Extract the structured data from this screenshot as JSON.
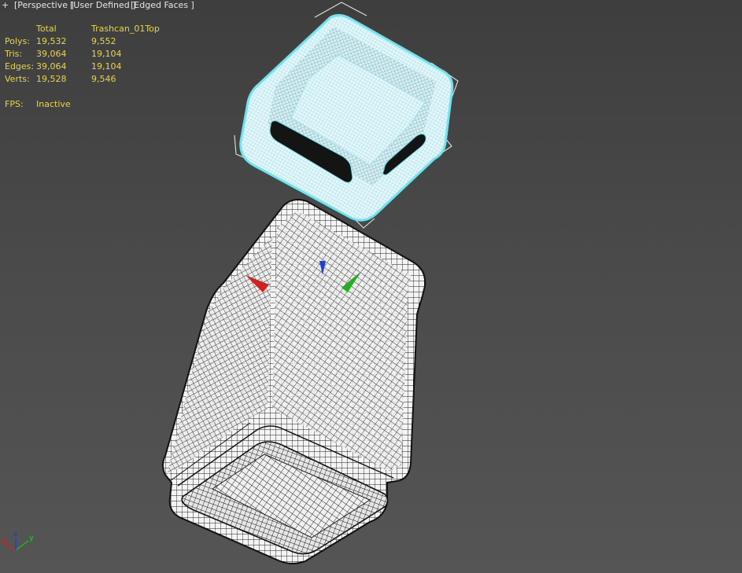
{
  "viewport_labels": {
    "plus": "+",
    "view": "[Perspective ]",
    "user_defined": "[User Defined ]",
    "shading": "[Edged Faces ]"
  },
  "stats": {
    "header": {
      "total": "Total",
      "selected": "Trashcan_01Top"
    },
    "rows": [
      {
        "label": "Polys:",
        "total": "19,532",
        "selected": "9,552"
      },
      {
        "label": "Tris:",
        "total": "39,064",
        "selected": "19,104"
      },
      {
        "label": "Edges:",
        "total": "39,064",
        "selected": "19,104"
      },
      {
        "label": "Verts:",
        "total": "19,528",
        "selected": "9,546"
      }
    ],
    "fps": {
      "label": "FPS:",
      "value": "Inactive"
    }
  },
  "axis_tripod": {
    "x": "x",
    "y": "y",
    "z": "z"
  },
  "colors": {
    "stats_text": "#e8d44d",
    "selection": "#6fe3f0",
    "background": "#4a4a4a",
    "axis_x": "#d22020",
    "axis_y": "#20b020",
    "axis_z": "#2040d0"
  }
}
